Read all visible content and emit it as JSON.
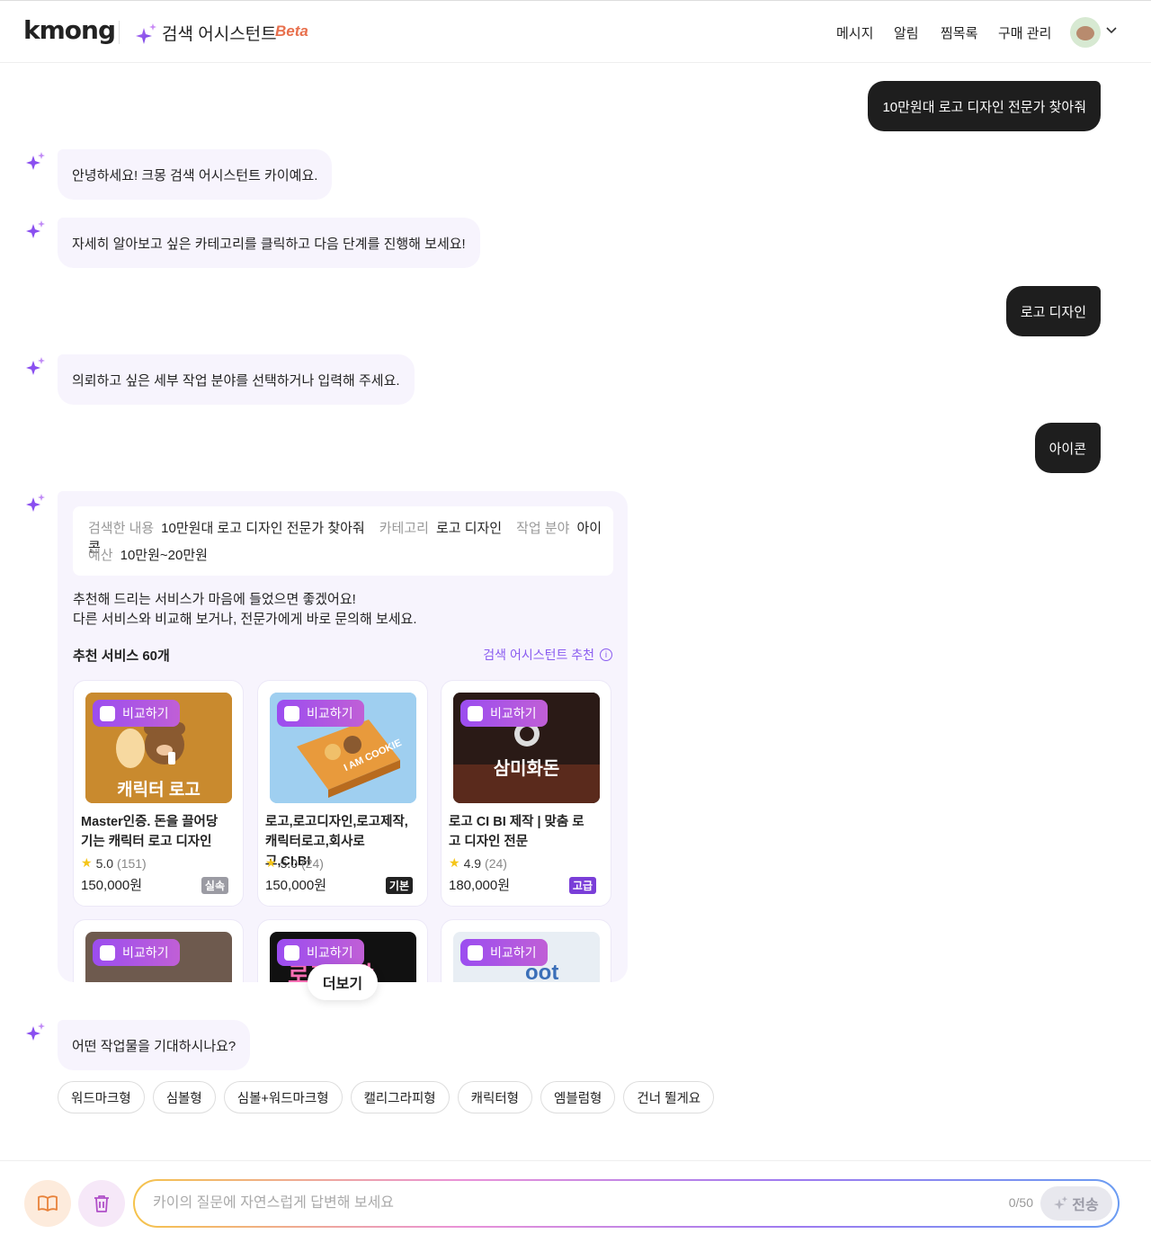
{
  "header": {
    "logo": "kmong",
    "assistant_title": "검색 어시스턴트",
    "beta": "Beta",
    "nav": [
      "메시지",
      "알림",
      "찜목록",
      "구매 관리"
    ]
  },
  "chat": {
    "user_msg_1": "10만원대 로고 디자인 전문가 찾아줘",
    "ai_msg_1": "안녕하세요! 크몽 검색 어시스턴트 카이예요.",
    "ai_msg_2": "자세히 알아보고 싶은 카테고리를 클릭하고 다음 단계를 진행해 보세요!",
    "user_msg_2": "로고 디자인",
    "ai_msg_3": "의뢰하고 싶은 세부 작업 분야를 선택하거나 입력해 주세요.",
    "user_msg_3": "아이콘",
    "summary": {
      "search_label": "검색한 내용",
      "search_value": "10만원대 로고 디자인 전문가 찾아줘",
      "category_label": "카테고리",
      "category_value": "로고 디자인",
      "field_label": "작업 분야",
      "field_value": "아이콘",
      "budget_label": "예산",
      "budget_value": "10만원~20만원"
    },
    "recommend_line1": "추천해 드리는 서비스가 마음에 들었으면 좋겠어요!",
    "recommend_line2": "다른 서비스와 비교해 보거나, 전문가에게 바로 문의해 보세요.",
    "recommend_title": "추천 서비스 60개",
    "recommend_link": "검색 어시스턴트 추천",
    "compare_label": "비교하기",
    "more_label": "더보기",
    "ai_msg_4": "어떤 작업물을 기대하시나요?",
    "chips": [
      "워드마크형",
      "심볼형",
      "심볼+워드마크형",
      "캘리그라피형",
      "캐릭터형",
      "엠블럼형",
      "건너 뛸게요"
    ]
  },
  "products": [
    {
      "title": "Master인증. 돈을 끌어당기는 캐릭터 로고 디자인",
      "rating": "5.0",
      "count": "(151)",
      "price": "150,000원",
      "tier": "실속",
      "tier_color": "#9b9ba3",
      "image_text": "캐릭터 로고",
      "image_bg": "#c98a2e"
    },
    {
      "title": "로고,로고디자인,로고제작,캐릭터로고,회사로고,CI,BI",
      "rating": "5.0",
      "count": "(24)",
      "price": "150,000원",
      "tier": "기본",
      "tier_color": "#222222",
      "image_text": "I AM COOKIE",
      "image_bg": "#9fcff0"
    },
    {
      "title": "로고 CI BI 제작 | 맞춤 로고 디자인 전문",
      "rating": "4.9",
      "count": "(24)",
      "price": "180,000원",
      "tier": "고급",
      "tier_color": "#7a3ed8",
      "image_text": "삼미화돈",
      "image_bg": "#2a1a16"
    }
  ],
  "products_partial": [
    {
      "image_bg": "#6e5a4e",
      "image_text": ""
    },
    {
      "image_bg": "#111111",
      "image_text": "로고제작"
    },
    {
      "image_bg": "#e8eef4",
      "image_text": "oot"
    }
  ],
  "footer": {
    "placeholder": "카이의 질문에 자연스럽게 답변해 보세요",
    "counter": "0/50",
    "send": "전송"
  }
}
